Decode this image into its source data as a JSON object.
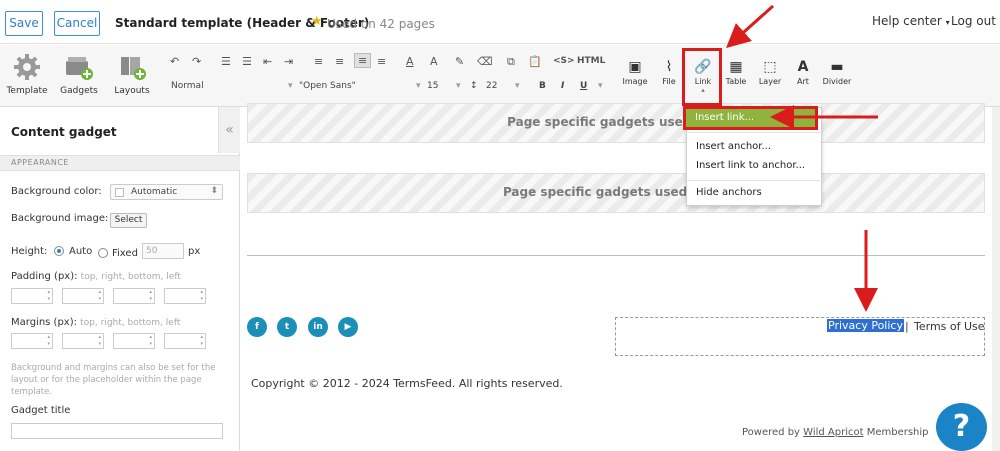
{
  "topbar": {
    "save_label": "Save",
    "cancel_label": "Cancel",
    "template_title": "Standard template (Header & Footer)",
    "used_on": "Used on 42 pages",
    "help_center": "Help center",
    "log_out": "Log out"
  },
  "toolbar": {
    "template_label": "Template",
    "gadgets_label": "Gadgets",
    "layouts_label": "Layouts",
    "paragraph_style": "Normal",
    "font_family": "\"Open Sans\"",
    "font_size": "15",
    "line_height": "22",
    "bold": "B",
    "italic": "I",
    "underline": "U",
    "strike": "<S>",
    "html": "HTML",
    "image_label": "Image",
    "file_label": "File",
    "link_label": "Link",
    "table_label": "Table",
    "layer_label": "Layer",
    "art_label": "Art",
    "divider_label": "Divider"
  },
  "link_menu": {
    "insert_link": "Insert link...",
    "insert_anchor": "Insert anchor...",
    "insert_link_to_anchor": "Insert link to anchor...",
    "hide_anchors": "Hide anchors"
  },
  "left_panel": {
    "title": "Content gadget",
    "section": "APPEARANCE",
    "bg_color_label": "Background color:",
    "bg_color_value": "Automatic",
    "bg_image_label": "Background image:",
    "select_label": "Select",
    "height_label": "Height:",
    "auto_label": "Auto",
    "fixed_label": "Fixed",
    "fixed_value": "50",
    "px_label": "px",
    "padding_label": "Padding (px):",
    "padding_hint": "top, right, bottom, left",
    "margins_label": "Margins (px):",
    "margins_hint": "top, right, bottom, left",
    "note": "Background and margins can also be set for the layout or for the placeholder within the page template.",
    "gadget_title_label": "Gadget title"
  },
  "canvas": {
    "placeholder_1": "Page specific gadgets used on 1",
    "placeholder_2": "Page specific gadgets used on 40",
    "privacy_policy": "Privacy Policy",
    "separator": "|",
    "terms_of_use": "Terms of Use",
    "copyright": "Copyright © 2012 - 2024 TermsFeed. All rights reserved.",
    "powered_by": "Powered by",
    "wild_apricot": "Wild Apricot",
    "membership": "Membership",
    "help_glyph": "?"
  },
  "social": [
    "f",
    "t",
    "in",
    "▶"
  ],
  "colors": {
    "accent": "#2a7fd0",
    "menu_highlight": "#8fb33c",
    "annotation": "#d91c1c",
    "social": "#1a8fb8"
  }
}
